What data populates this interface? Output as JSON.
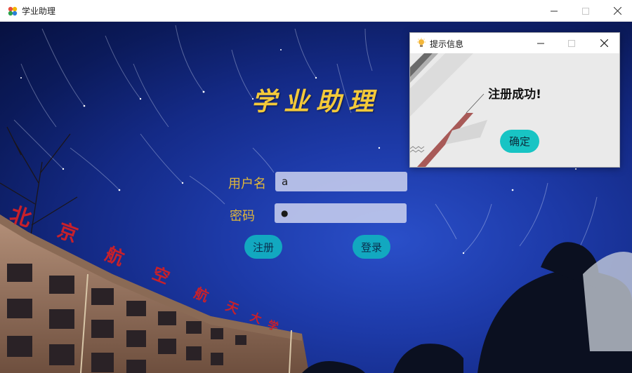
{
  "window": {
    "title": "学业助理",
    "icon": "app-logo-icon"
  },
  "login": {
    "heading": "学业助理",
    "username_label": "用户名",
    "username_value": "a",
    "password_label": "密码",
    "password_value": "●",
    "register_label": "注册",
    "login_label": "登录"
  },
  "dialog": {
    "title": "提示信息",
    "icon": "lightbulb-icon",
    "message": "注册成功!",
    "ok_label": "确定"
  },
  "colors": {
    "heading": "#f3c93a",
    "label": "#e0b73b",
    "button": "#12a8c0",
    "ok_button": "#18c4c4"
  }
}
